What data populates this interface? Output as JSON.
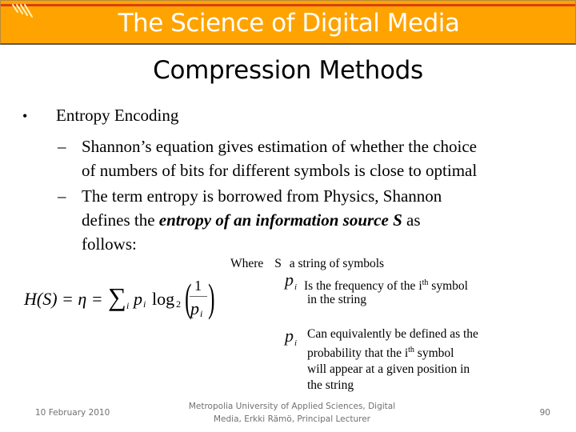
{
  "header": {
    "title": "The Science of Digital Media",
    "logo_icon": "stripes-logo-icon",
    "colors": {
      "bar": "#FFA300",
      "stripe": "#D8400C",
      "text": "#FFFFFF"
    }
  },
  "slide": {
    "title": "Compression Methods",
    "bullet": "Entropy Encoding",
    "sub_bullets": [
      {
        "marker": "–",
        "line1": "Shannon’s equation gives estimation of whether the choice",
        "line2": "of numbers of bits for different symbols is close to optimal"
      },
      {
        "marker": "–",
        "line1": "The term entropy is borrowed from Physics, Shannon",
        "line2_pre": "defines the ",
        "line2_emph": "entropy of an information source S",
        "line2_post": " as",
        "line3": "follows:"
      }
    ],
    "formula": {
      "lhs": "H(S) = η =",
      "sum_symbol": "∑",
      "sum_index": "i",
      "term": "p",
      "term_sub": "i",
      "log": "log",
      "log_base": "2",
      "numerator": "1",
      "denominator": "p",
      "denominator_sub": "i"
    },
    "legend": {
      "where": "Where",
      "s_symbol": "S",
      "s_desc": "a string of symbols",
      "p_symbol": "p",
      "p_sub": "i",
      "p1_desc_a": "Is the frequency of the i",
      "p1_desc_sup": "th",
      "p1_desc_b": " symbol",
      "p1_desc_line2": "in the string",
      "p2_line1": "Can equivalently be defined as the",
      "p2_line2_a": "probability that the i",
      "p2_line2_sup": "th",
      "p2_line2_b": " symbol",
      "p2_line3": "will appear at a given position in",
      "p2_line4": "the string"
    }
  },
  "footer": {
    "date": "10 February 2010",
    "center_line1": "Metropolia University of Applied Sciences,  Digital",
    "center_line2": "Media, Erkki Rämö, Principal Lecturer",
    "page": "90"
  }
}
